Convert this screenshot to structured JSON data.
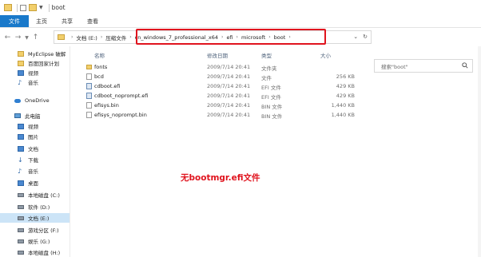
{
  "window": {
    "title": "boot"
  },
  "ribbon": {
    "tabs": [
      "文件",
      "主页",
      "共享",
      "查看"
    ]
  },
  "address": {
    "crumbs": [
      "文档 (E:)",
      "压缩文件",
      "cn_windows_7_professional_x64",
      "efi",
      "microsoft",
      "boot"
    ],
    "search_placeholder": "搜索\"boot\""
  },
  "highlight_color": "#e0141e",
  "accent_color": "#1979ca",
  "sidebar": {
    "items": [
      {
        "label": "MyEclipse 破解",
        "icon": "folder-icon"
      },
      {
        "label": "百度回家计划",
        "icon": "folder-icon"
      },
      {
        "label": "视频",
        "icon": "video-icon"
      },
      {
        "label": "音乐",
        "icon": "music-icon"
      },
      {
        "label": "OneDrive",
        "icon": "cloud-icon"
      },
      {
        "label": "此电脑",
        "icon": "pc-icon"
      },
      {
        "label": "视频",
        "icon": "video-icon"
      },
      {
        "label": "图片",
        "icon": "picture-icon"
      },
      {
        "label": "文档",
        "icon": "document-icon"
      },
      {
        "label": "下载",
        "icon": "download-icon"
      },
      {
        "label": "音乐",
        "icon": "music-icon"
      },
      {
        "label": "桌面",
        "icon": "desktop-icon"
      },
      {
        "label": "本地磁盘 (C:)",
        "icon": "drive-icon"
      },
      {
        "label": "软件 (D:)",
        "icon": "drive-icon"
      },
      {
        "label": "文档 (E:)",
        "icon": "drive-icon",
        "selected": true
      },
      {
        "label": "游戏分区 (F:)",
        "icon": "drive-icon"
      },
      {
        "label": "娱乐 (G:)",
        "icon": "drive-icon"
      },
      {
        "label": "本地磁盘 (H:)",
        "icon": "drive-icon"
      }
    ]
  },
  "columns": {
    "name": "名称",
    "date": "修改日期",
    "type": "类型",
    "size": "大小"
  },
  "files": [
    {
      "name": "fonts",
      "date": "2009/7/14 20:41",
      "type": "文件夹",
      "size": "",
      "icon": "folder"
    },
    {
      "name": "bcd",
      "date": "2009/7/14 20:41",
      "type": "文件",
      "size": "256 KB",
      "icon": "file"
    },
    {
      "name": "cdboot.efi",
      "date": "2009/7/14 20:41",
      "type": "EFI 文件",
      "size": "429 KB",
      "icon": "efi"
    },
    {
      "name": "cdboot_noprompt.efi",
      "date": "2009/7/14 20:41",
      "type": "EFI 文件",
      "size": "429 KB",
      "icon": "efi"
    },
    {
      "name": "efisys.bin",
      "date": "2009/7/14 20:41",
      "type": "BIN 文件",
      "size": "1,440 KB",
      "icon": "file"
    },
    {
      "name": "efisys_noprompt.bin",
      "date": "2009/7/14 20:41",
      "type": "BIN 文件",
      "size": "1,440 KB",
      "icon": "file"
    }
  ],
  "annotation": "无bootmgr.efi文件"
}
